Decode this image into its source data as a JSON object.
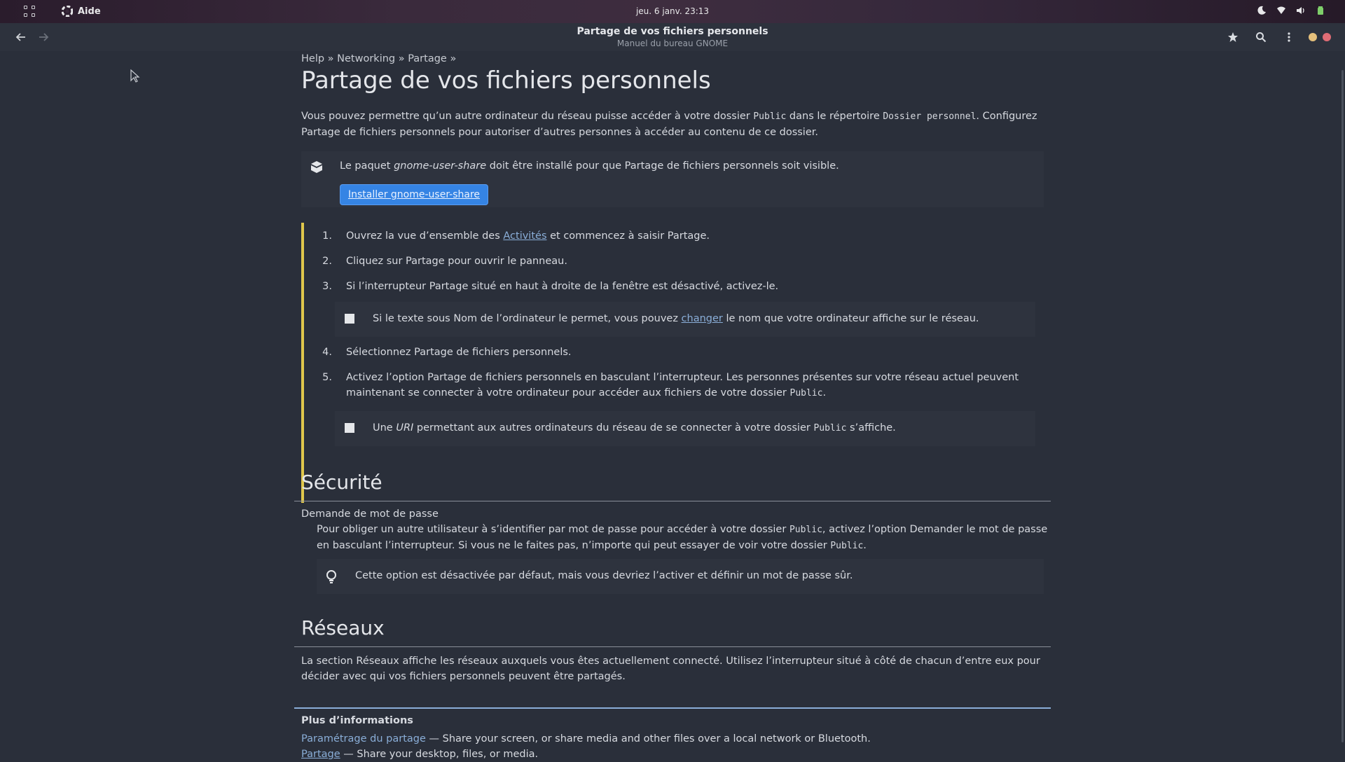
{
  "topbar": {
    "app_name": "Aide",
    "clock": "jeu. 6 janv.  23:13",
    "icons": [
      "apps-grid-icon",
      "help-app-icon",
      "night-light-icon",
      "wifi-icon",
      "volume-icon",
      "battery-icon"
    ]
  },
  "headerbar": {
    "title": "Partage de vos fichiers personnels",
    "subtitle": "Manuel du bureau GNOME",
    "icons": [
      "back-arrow-icon",
      "forward-arrow-icon",
      "bookmark-star-icon",
      "search-icon",
      "menu-kebab-icon"
    ],
    "window_controls": {
      "minimize_color": "#e5c07b",
      "close_color": "#e06c75"
    }
  },
  "breadcrumb": "Help » Networking » Partage »",
  "page_title": "Partage de vos fichiers personnels",
  "intro": {
    "part1": "Vous pouvez permettre qu’un autre ordinateur du réseau puisse accéder à votre dossier ",
    "code1": "Public",
    "part2": " dans le répertoire ",
    "code2": "Dossier personnel",
    "part3": ". Configurez Partage de fichiers personnels pour autoriser d’autres personnes à accéder au contenu de ce dossier."
  },
  "package_note": {
    "pre": "Le paquet ",
    "pkg": "gnome-user-share",
    "post": " doit être installé pour que Partage de fichiers personnels soit visible.",
    "button": "Installer gnome-user-share"
  },
  "steps": [
    {
      "num": "1.",
      "pre": "Ouvrez la vue d’ensemble des ",
      "link": "Activités",
      "post": " et commencez à saisir Partage."
    },
    {
      "num": "2.",
      "text": "Cliquez sur Partage pour ouvrir le panneau."
    },
    {
      "num": "3.",
      "text": "Si l’interrupteur Partage situé en haut à droite de la fenêtre est désactivé, activez-le."
    },
    {
      "num": "4.",
      "text": "Sélectionnez Partage de fichiers personnels."
    },
    {
      "num": "5.",
      "text": "Activez l’option Partage de fichiers personnels en basculant l’interrupteur. Les personnes présentes sur votre réseau actuel peuvent maintenant se connecter à votre ordinateur pour accéder aux fichiers de votre dossier ",
      "code": "Public",
      "post": "."
    }
  ],
  "step3_note": {
    "pre": "Si le texte sous Nom de l’ordinateur le permet, vous pouvez ",
    "link": "changer",
    "post": " le nom que votre ordinateur affiche sur le réseau."
  },
  "step5_note": {
    "pre": "Une ",
    "em": "URI",
    "mid": " permettant aux autres ordinateurs du réseau de se connecter à votre dossier ",
    "code": "Public",
    "post": " s’affiche."
  },
  "security": {
    "heading": "Sécurité",
    "term": "Demande de mot de passe",
    "desc_pre": "Pour obliger un autre utilisateur à s’identifier par mot de passe pour accéder à votre dossier ",
    "desc_code1": "Public",
    "desc_mid": ", activez l’option Demander le mot de passe en basculant l’interrupteur. Si vous ne le faites pas, n’importe qui peut essayer de voir votre dossier ",
    "desc_code2": "Public",
    "desc_post": ".",
    "tip": "Cette option est désactivée par défaut, mais vous devriez l’activer et définir un mot de passe sûr."
  },
  "networks": {
    "heading": "Réseaux",
    "text": "La section Réseaux affiche les réseaux auxquels vous êtes actuellement connecté. Utilisez l’interrupteur situé à côté de chacun d’entre eux pour décider avec qui vos fichiers personnels peuvent être partagés."
  },
  "more_info": {
    "title": "Plus d’informations",
    "links": [
      {
        "label": "Paramétrage du partage",
        "desc": " — Share your screen, or share media and other files over a local network or Bluetooth."
      },
      {
        "label": "Partage",
        "desc": " — Share your desktop, files, or media."
      }
    ]
  }
}
